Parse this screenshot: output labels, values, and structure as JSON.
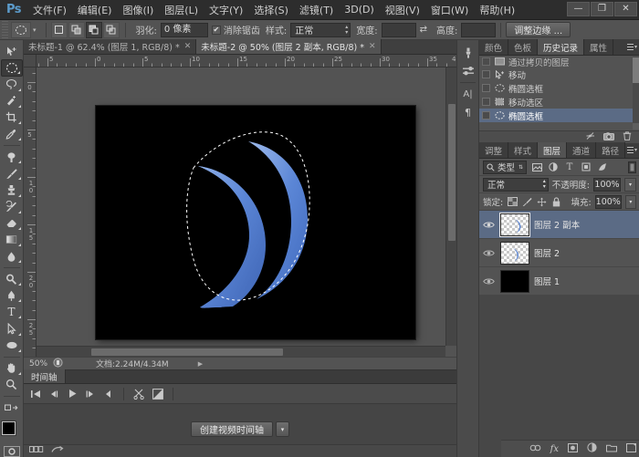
{
  "app": {
    "logo": "Ps",
    "menus": [
      {
        "label": "文件(F)"
      },
      {
        "label": "编辑(E)"
      },
      {
        "label": "图像(I)"
      },
      {
        "label": "图层(L)"
      },
      {
        "label": "文字(Y)"
      },
      {
        "label": "选择(S)"
      },
      {
        "label": "滤镜(T)"
      },
      {
        "label": "3D(D)"
      },
      {
        "label": "视图(V)"
      },
      {
        "label": "窗口(W)"
      },
      {
        "label": "帮助(H)"
      }
    ],
    "window_buttons": {
      "minimize": "—",
      "maximize": "❐",
      "close": "✕"
    }
  },
  "options_bar": {
    "tool_icon": "ellipse-marquee-icon",
    "preset_caret": "▾",
    "bool_modes": [
      {
        "name": "new-selection",
        "glyph": "▢"
      },
      {
        "name": "add-to-selection",
        "glyph": "▣"
      },
      {
        "name": "subtract-from-selection",
        "glyph": "▤"
      },
      {
        "name": "intersect-selection",
        "glyph": "▥"
      }
    ],
    "feather_label": "羽化:",
    "feather_value": "0 像素",
    "antialias_label": "消除锯齿",
    "antialias_checked": "✔",
    "style_label": "样式:",
    "style_value": "正常",
    "width_label": "宽度:",
    "width_value": "",
    "swap_glyph": "⇄",
    "height_label": "高度:",
    "height_value": "",
    "refine_edge_label": "调整边缘 ..."
  },
  "toolbar": {
    "tools": [
      {
        "name": "move-tool",
        "selected": false
      },
      {
        "name": "elliptical-marquee-tool",
        "selected": true
      },
      {
        "name": "lasso-tool",
        "selected": false
      },
      {
        "name": "quick-selection-tool",
        "selected": false
      },
      {
        "name": "crop-tool",
        "selected": false
      },
      {
        "name": "eyedropper-tool",
        "selected": false
      },
      {
        "name": "spot-healing-brush-tool",
        "selected": false
      },
      {
        "name": "brush-tool",
        "selected": false
      },
      {
        "name": "clone-stamp-tool",
        "selected": false
      },
      {
        "name": "history-brush-tool",
        "selected": false
      },
      {
        "name": "eraser-tool",
        "selected": false
      },
      {
        "name": "gradient-tool",
        "selected": false
      },
      {
        "name": "blur-tool",
        "selected": false
      },
      {
        "name": "dodge-tool",
        "selected": false
      },
      {
        "name": "pen-tool",
        "selected": false
      },
      {
        "name": "type-tool",
        "selected": false
      },
      {
        "name": "path-selection-tool",
        "selected": false
      },
      {
        "name": "ellipse-shape-tool",
        "selected": false
      },
      {
        "name": "hand-tool",
        "selected": false
      },
      {
        "name": "zoom-tool",
        "selected": false
      }
    ],
    "type_tool_glyph": "T",
    "foreground_color": "#000000",
    "background_color": "#4e78cd"
  },
  "document_tabs": [
    {
      "label": "未标题-1 @ 62.4% (图层 1, RGB/8) *",
      "close": "✕",
      "active": false
    },
    {
      "label": "未标题-2 @ 50% (图层 2 副本, RGB/8) *",
      "close": "✕",
      "active": true
    }
  ],
  "rulers": {
    "horizontal": [
      "5",
      "0",
      "5",
      "10",
      "15",
      "20",
      "25",
      "30",
      "35",
      "40"
    ],
    "vertical": [
      "0",
      "5",
      "10",
      "15",
      "20",
      "25"
    ]
  },
  "canvas": {
    "background": "#000000",
    "shape_color": "#5b86d6",
    "shape_highlight": "#8fb0e8",
    "selection_stroke": "#ffffff"
  },
  "status_bar": {
    "zoom": "50%",
    "doc_icon": "doc-info-icon",
    "doc_info": "文档:2.24M/4.34M",
    "expand_arrow": "▶"
  },
  "timeline": {
    "tab_label": "时间轴",
    "transport": [
      {
        "name": "go-to-first-frame",
        "glyph": "|◀"
      },
      {
        "name": "previous-frame",
        "glyph": "◀|"
      },
      {
        "name": "play",
        "glyph": "▶"
      },
      {
        "name": "next-frame",
        "glyph": "|▶"
      },
      {
        "name": "audio-mute",
        "glyph": "◀"
      }
    ],
    "split_icon": "scissors-icon",
    "transition_icon": "transition-icon",
    "create_button": "创建视频时间轴",
    "create_dropdown": "▾",
    "footer_icons": [
      "frame-mode-icon",
      "convert-to-frame-animation-icon"
    ]
  },
  "dock": {
    "collapsed_icons": [
      {
        "name": "history-brush-panel-icon"
      },
      {
        "name": "adjustments-panel-icon"
      },
      {
        "name": "character-panel-icon",
        "glyph": "A|"
      },
      {
        "name": "paragraph-panel-icon",
        "glyph": "¶"
      }
    ],
    "history_group": {
      "tabs": [
        {
          "label": "颜色",
          "active": false
        },
        {
          "label": "色板",
          "active": false
        },
        {
          "label": "历史记录",
          "active": true
        },
        {
          "label": "属性",
          "active": false
        }
      ],
      "items": [
        {
          "label": "通过拷贝的图层",
          "icon": "layer-icon",
          "selected": false
        },
        {
          "label": "移动",
          "icon": "move-icon",
          "selected": false
        },
        {
          "label": "椭圆选框",
          "icon": "ellipse-marquee-icon",
          "selected": false
        },
        {
          "label": "移动选区",
          "icon": "move-selection-icon",
          "selected": false
        },
        {
          "label": "椭圆选框",
          "icon": "ellipse-marquee-icon",
          "selected": true
        }
      ],
      "footer_icons": [
        {
          "name": "create-document-from-state-icon"
        },
        {
          "name": "create-new-snapshot-icon"
        },
        {
          "name": "delete-state-icon"
        }
      ]
    },
    "layers_group": {
      "tabs": [
        {
          "label": "调整",
          "active": false
        },
        {
          "label": "样式",
          "active": false
        },
        {
          "label": "图层",
          "active": true
        },
        {
          "label": "通道",
          "active": false
        },
        {
          "label": "路径",
          "active": false
        }
      ],
      "filter_label": "类型",
      "filter_icons": [
        "filter-pixel-icon",
        "filter-adjustment-icon",
        "filter-type-icon",
        "filter-shape-icon",
        "filter-smart-icon"
      ],
      "blend_mode": "正常",
      "opacity_label": "不透明度:",
      "opacity_value": "100%",
      "lock_label": "锁定:",
      "lock_icons": [
        "lock-transparent-pixels-icon",
        "lock-image-pixels-icon",
        "lock-position-icon",
        "lock-all-icon"
      ],
      "fill_label": "填充:",
      "fill_value": "100%",
      "layers": [
        {
          "name": "图层 2 副本",
          "thumb": "crescent",
          "selected": true,
          "visible": true
        },
        {
          "name": "图层 2",
          "thumb": "crescent",
          "selected": false,
          "visible": true
        },
        {
          "name": "图层 1",
          "thumb": "black",
          "selected": false,
          "visible": true
        }
      ],
      "footer_icons": [
        {
          "name": "link-layers-icon",
          "glyph": "∞"
        },
        {
          "name": "layer-style-icon",
          "glyph": "fx"
        },
        {
          "name": "layer-mask-icon",
          "glyph": "▣"
        },
        {
          "name": "new-fill-adjustment-icon",
          "glyph": "◑"
        },
        {
          "name": "new-group-icon",
          "glyph": "▭"
        },
        {
          "name": "new-layer-icon",
          "glyph": "▢"
        },
        {
          "name": "delete-layer-icon",
          "glyph": "🗑"
        }
      ]
    }
  }
}
